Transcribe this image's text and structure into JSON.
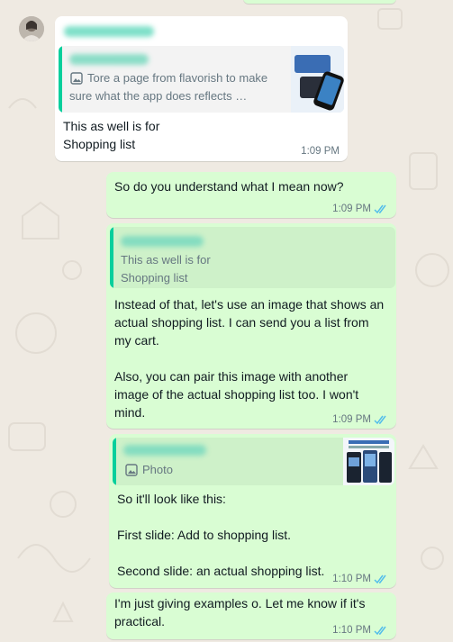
{
  "messages": {
    "m1": {
      "quote_text": "Tore a page from flavorish to make sure what the app does reflects …",
      "text": "This as well is for\nShopping list",
      "time": "1:09 PM"
    },
    "m2": {
      "text": "So do you understand what I mean now?",
      "time": "1:09 PM"
    },
    "m3": {
      "quote_text": "This as well is for\nShopping list",
      "text": "Instead of that, let's use an image that shows an\nactual shopping list. I can send you a list from\nmy cart.\n\nAlso, you can pair this image with another\nimage of the actual shopping list too. I won't\nmind.",
      "time": "1:09 PM"
    },
    "m4": {
      "quote_text": "Photo",
      "text": "So it'll look like this:\n\nFirst slide: Add to shopping list.\n\nSecond slide: an actual shopping list.",
      "time": "1:10 PM"
    },
    "m5": {
      "text": "I'm just giving examples o. Let me know if it's\npractical.",
      "time": "1:10 PM"
    }
  },
  "colors": {
    "background": "#efeae2",
    "incoming": "#ffffff",
    "outgoing": "#d9fdd3",
    "quote_bar": "#06cf9c",
    "read_ticks": "#53bdeb"
  },
  "icons": [
    "avatar",
    "image-icon",
    "double-check-icon"
  ]
}
